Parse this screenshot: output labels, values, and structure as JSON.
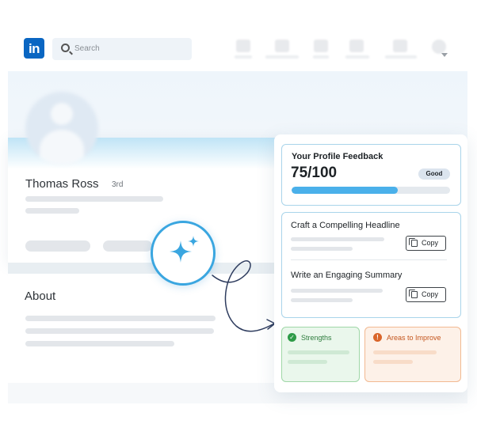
{
  "nav": {
    "logo_text": "in",
    "search_placeholder": "Search"
  },
  "profile": {
    "name": "Thomas Ross",
    "degree": "3rd",
    "about_title": "About"
  },
  "feedback": {
    "title": "Your Profile Feedback",
    "score": "75/100",
    "score_fraction": 0.67,
    "rating": "Good"
  },
  "suggestions": [
    {
      "title": "Craft a Compelling Headline",
      "button": "Copy"
    },
    {
      "title": "Write an Engaging Summary",
      "button": "Copy"
    }
  ],
  "strengths": {
    "icon": "check-icon",
    "label": "Strengths"
  },
  "improve": {
    "icon": "exclamation-icon",
    "label": "Areas to Improve"
  },
  "colors": {
    "brand": "#0a66c2",
    "accent": "#3aa6e0",
    "progress": "#4ab0ea",
    "strength": "#2e9b48",
    "improve": "#d9652a"
  }
}
